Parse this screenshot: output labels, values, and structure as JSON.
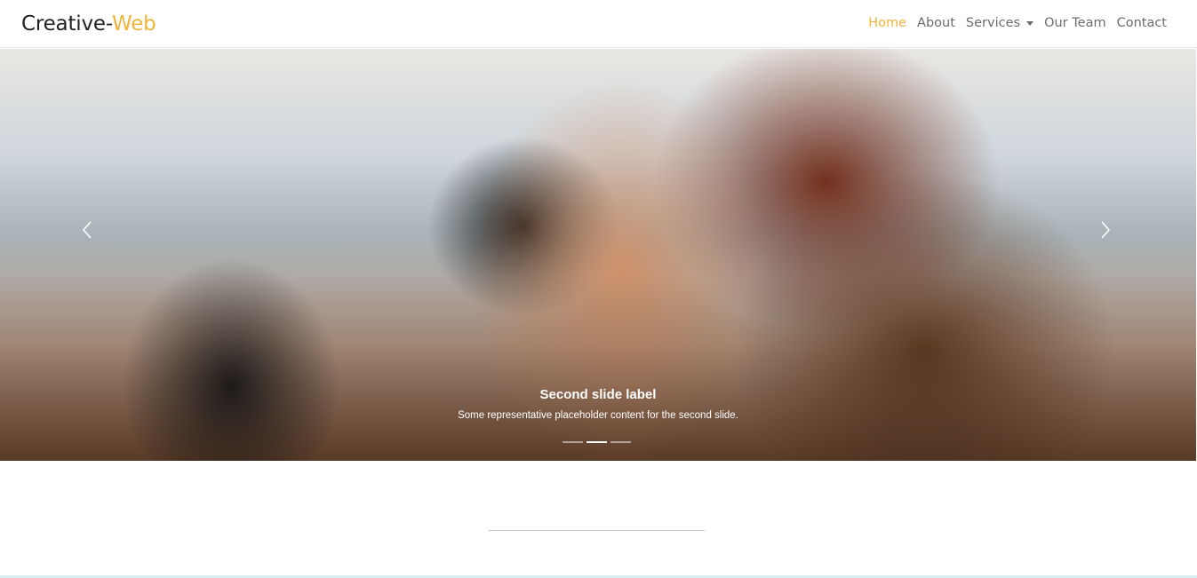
{
  "brand": {
    "part1": "Creative-",
    "part2": "Web"
  },
  "nav": {
    "items": [
      {
        "label": "Home",
        "active": true
      },
      {
        "label": "About"
      },
      {
        "label": "Services",
        "dropdown": true
      },
      {
        "label": "Our Team"
      },
      {
        "label": "Contact"
      }
    ]
  },
  "carousel": {
    "caption_title": "Second slide label",
    "caption_text": "Some representative placeholder content for the second slide.",
    "slide_count": 3,
    "active_slide": 2
  },
  "colors": {
    "accent": "#f0b43a",
    "nav_text": "#6c6c6c"
  },
  "icons": {
    "prev": "chevron-left-icon",
    "next": "chevron-right-icon",
    "dropdown": "caret-down-icon"
  }
}
